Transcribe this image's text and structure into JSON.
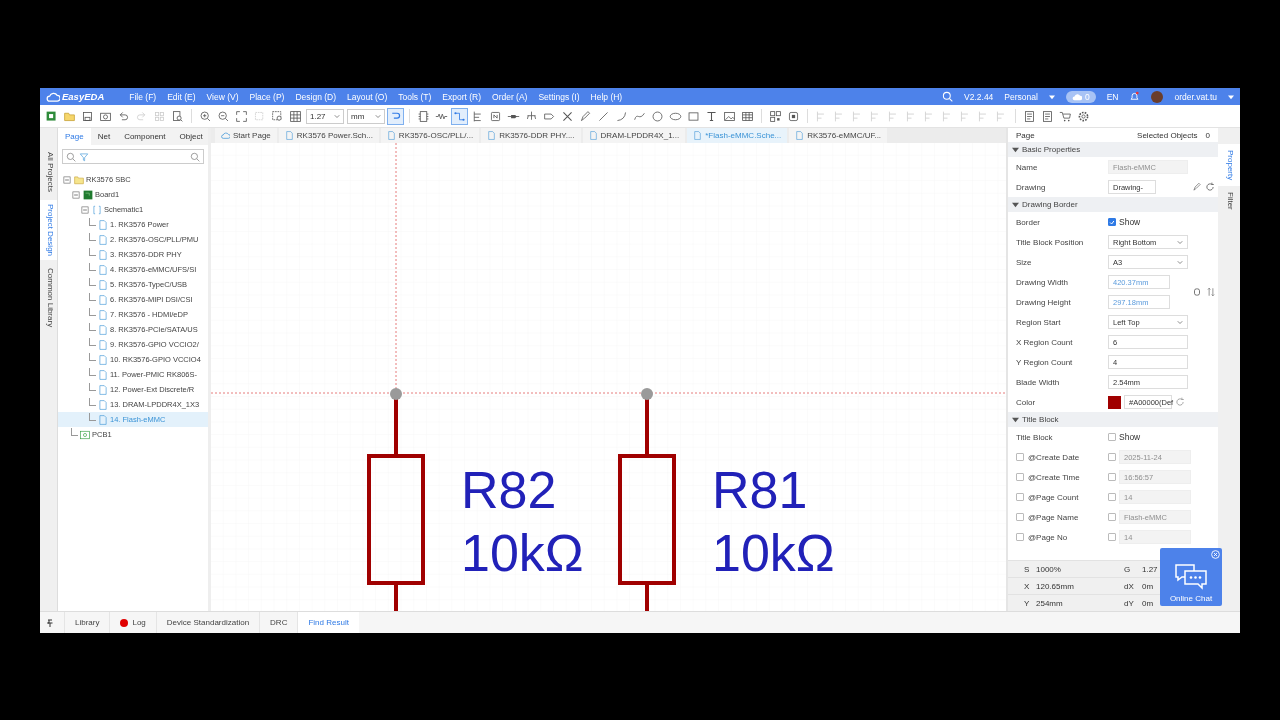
{
  "app": {
    "name": "EasyEDA"
  },
  "menu": [
    "File (F)",
    "Edit (E)",
    "View (V)",
    "Place (P)",
    "Design (D)",
    "Layout (O)",
    "Tools (T)",
    "Export (R)",
    "Order (A)",
    "Settings (I)",
    "Help (H)"
  ],
  "account": {
    "version": "V2.2.44",
    "plan": "Personal",
    "cloud_count": "0",
    "language": "EN",
    "user": "order.vat.tu"
  },
  "toolbar": {
    "grid": "1.27",
    "unit": "mm"
  },
  "side_tabs": [
    {
      "label": "All Projects",
      "selected": false
    },
    {
      "label": "Project Design",
      "selected": true
    },
    {
      "label": "Common Library",
      "selected": false
    }
  ],
  "panel_tabs": [
    {
      "label": "Page",
      "selected": true
    },
    {
      "label": "Net",
      "selected": false
    },
    {
      "label": "Component",
      "selected": false
    },
    {
      "label": "Object",
      "selected": false
    }
  ],
  "tree": [
    {
      "label": "RK3576 SBC",
      "kind": "project",
      "expanded": true,
      "children": [
        {
          "label": "Board1",
          "kind": "board",
          "expanded": true,
          "children": [
            {
              "label": "Schematic1",
              "kind": "schematic",
              "expanded": true,
              "children": [
                {
                  "label": "1. RK3576 Power",
                  "kind": "page",
                  "selected": false
                },
                {
                  "label": "2. RK3576-OSC/PLL/PMU",
                  "kind": "page",
                  "selected": false
                },
                {
                  "label": "3. RK3576-DDR PHY",
                  "kind": "page",
                  "selected": false
                },
                {
                  "label": "4. RK3576-eMMC/UFS/SI",
                  "kind": "page",
                  "selected": false
                },
                {
                  "label": "5. RK3576-TypeC/USB",
                  "kind": "page",
                  "selected": false
                },
                {
                  "label": "6. RK3576-MIPI DSI/CSI",
                  "kind": "page",
                  "selected": false
                },
                {
                  "label": "7. RK3576 - HDMI/eDP",
                  "kind": "page",
                  "selected": false
                },
                {
                  "label": "8. RK3576-PCIe/SATA/US",
                  "kind": "page",
                  "selected": false
                },
                {
                  "label": "9. RK3576-GPIO VCCIO2/",
                  "kind": "page",
                  "selected": false
                },
                {
                  "label": "10. RK3576-GPIO VCCIO4",
                  "kind": "page",
                  "selected": false
                },
                {
                  "label": "11. Power-PMIC RK806S-",
                  "kind": "page",
                  "selected": false
                },
                {
                  "label": "12. Power-Ext Discrete/R",
                  "kind": "page",
                  "selected": false
                },
                {
                  "label": "13. DRAM-LPDDR4X_1X3",
                  "kind": "page",
                  "selected": false
                },
                {
                  "label": "14. Flash-eMMC",
                  "kind": "page",
                  "selected": true
                }
              ]
            }
          ]
        },
        {
          "label": "PCB1",
          "kind": "pcb"
        }
      ]
    }
  ],
  "doc_tabs": [
    {
      "label": "Start Page",
      "kind": "start",
      "selected": false
    },
    {
      "label": "RK3576 Power.Sch...",
      "kind": "page",
      "selected": false
    },
    {
      "label": "RK3576-OSC/PLL/...",
      "kind": "page",
      "selected": false
    },
    {
      "label": "RK3576-DDR PHY....",
      "kind": "page",
      "selected": false
    },
    {
      "label": "DRAM-LPDDR4X_1...",
      "kind": "page",
      "selected": false
    },
    {
      "label": "*Flash-eMMC.Sche...",
      "kind": "page",
      "selected": true
    },
    {
      "label": "RK3576-eMMC/UF...",
      "kind": "page",
      "selected": false
    }
  ],
  "canvas": {
    "parts": [
      {
        "designator": "R82",
        "value": "10kΩ"
      },
      {
        "designator": "R81",
        "value": "10kΩ"
      }
    ]
  },
  "properties": {
    "title": "Page",
    "selected_label": "Selected Objects",
    "selected_count": "0",
    "sections": [
      {
        "title": "Basic Properties",
        "expanded": true,
        "rows": [
          {
            "label": "Name",
            "kind": "readonly",
            "value": "Flash-eMMC"
          },
          {
            "label": "Drawing",
            "kind": "picker",
            "value": "Drawing-"
          }
        ]
      },
      {
        "title": "Drawing Border",
        "expanded": true,
        "rows": [
          {
            "label": "Border",
            "kind": "checkbox",
            "checked": true,
            "value": "Show"
          },
          {
            "label": "Title Block Position",
            "kind": "select",
            "value": "Right Bottom"
          },
          {
            "label": "Size",
            "kind": "select",
            "value": "A3"
          },
          {
            "label": "Drawing Width",
            "kind": "dimension",
            "value": "420.37mm"
          },
          {
            "label": "Drawing Height",
            "kind": "dimension",
            "value": "297.18mm"
          },
          {
            "label": "Region Start",
            "kind": "select",
            "value": "Left Top"
          },
          {
            "label": "X Region Count",
            "kind": "input",
            "value": "6"
          },
          {
            "label": "Y Region Count",
            "kind": "input",
            "value": "4"
          },
          {
            "label": "Blade Width",
            "kind": "input",
            "value": "2.54mm"
          },
          {
            "label": "Color",
            "kind": "color",
            "color": "#a00000",
            "value": "#A00000(Def"
          }
        ]
      },
      {
        "title": "Title Block",
        "expanded": true,
        "rows": [
          {
            "label": "Title Block",
            "kind": "checkbox",
            "checked": false,
            "value": "Show"
          },
          {
            "label": "@Create Date",
            "kind": "attribute",
            "checked": false,
            "show_checked": false,
            "value": "2025-11-24"
          },
          {
            "label": "@Create Time",
            "kind": "attribute",
            "checked": false,
            "show_checked": false,
            "value": "16:56:57"
          },
          {
            "label": "@Page Count",
            "kind": "attribute",
            "checked": false,
            "show_checked": false,
            "value": "14"
          },
          {
            "label": "@Page Name",
            "kind": "attribute",
            "checked": false,
            "show_checked": false,
            "value": "Flash-eMMC"
          },
          {
            "label": "@Page No",
            "kind": "attribute",
            "checked": false,
            "show_checked": false,
            "value": "14"
          }
        ]
      }
    ]
  },
  "status": [
    {
      "label": "S",
      "value": "1000%",
      "label_2": "G",
      "value_2": "1.27"
    },
    {
      "label": "X",
      "value": "120.65mm",
      "label_2": "dX",
      "value_2": "0m"
    },
    {
      "label": "Y",
      "value": "254mm",
      "label_2": "dY",
      "value_2": "0m"
    }
  ],
  "right_tabs": [
    {
      "label": "Property",
      "selected": true
    },
    {
      "label": "Filter",
      "selected": false
    }
  ],
  "chat": {
    "label": "Online Chat"
  },
  "bottom_tabs": [
    {
      "label": "Library",
      "kind": "plain",
      "selected": false
    },
    {
      "label": "Log",
      "kind": "log",
      "selected": false
    },
    {
      "label": "Device Standardization",
      "kind": "plain",
      "selected": false
    },
    {
      "label": "DRC",
      "kind": "plain",
      "selected": false
    },
    {
      "label": "Find Result",
      "kind": "plain",
      "selected": true
    }
  ]
}
